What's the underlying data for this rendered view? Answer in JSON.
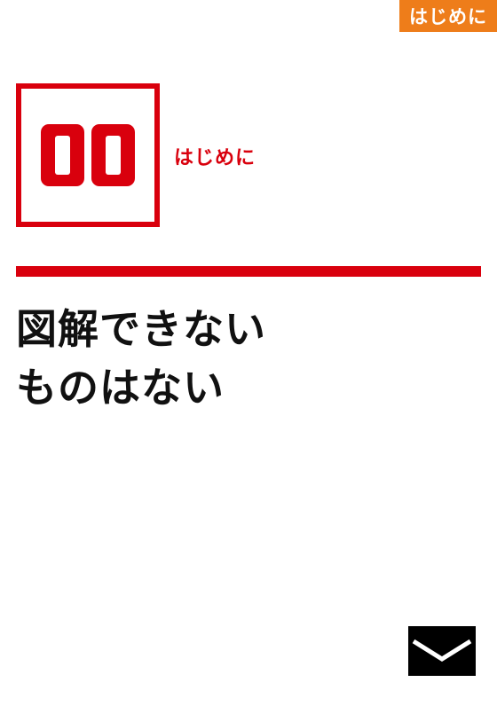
{
  "header": {
    "section_tab": "はじめに"
  },
  "chapter": {
    "number": "00",
    "label": "はじめに"
  },
  "headline": {
    "line1": "図解できない",
    "line2": "ものはない"
  },
  "navigation": {
    "next_icon": "chevron-down-icon"
  },
  "colors": {
    "accent_red": "#d9000d",
    "tab_orange": "#ee7d1a",
    "text": "#111111"
  }
}
